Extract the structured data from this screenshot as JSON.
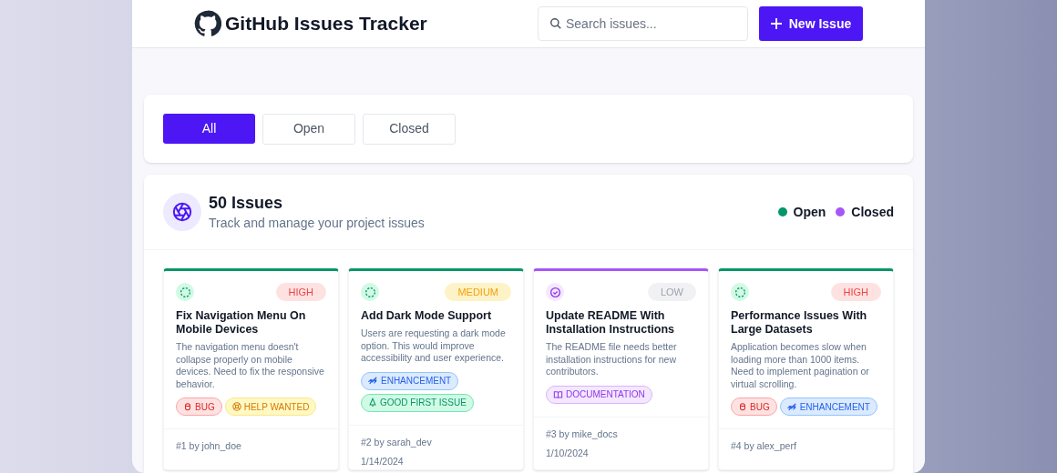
{
  "header": {
    "title": "GitHub Issues Tracker",
    "search": {
      "placeholder": "Search issues..."
    },
    "new_button": "New Issue"
  },
  "filters": [
    {
      "label": "All",
      "selected": true
    },
    {
      "label": "Open",
      "selected": false
    },
    {
      "label": "Closed",
      "selected": false
    }
  ],
  "summary": {
    "title": "50 Issues",
    "subtitle": "Track and manage your project issues",
    "legend": [
      {
        "label": "Open",
        "color": "#059669"
      },
      {
        "label": "Closed",
        "color": "#a855f7"
      }
    ]
  },
  "issues": [
    {
      "closed": false,
      "priority": {
        "label": "HIGH",
        "kind": "high"
      },
      "title": "Fix Navigation Menu On Mobile Devices",
      "description": "The navigation menu doesn't collapse properly on mobile devices. Need to fix the responsive behavior.",
      "labels": [
        {
          "kind": "bug",
          "text": "BUG"
        },
        {
          "kind": "help",
          "text": "HELP WANTED"
        }
      ],
      "meta": "#1 by john_doe"
    },
    {
      "closed": false,
      "priority": {
        "label": "MEDIUM",
        "kind": "medium"
      },
      "title": "Add Dark Mode Support",
      "description": "Users are requesting a dark mode option. This would improve accessibility and user experience.",
      "labels": [
        {
          "kind": "enhancement",
          "text": "ENHANCEMENT"
        },
        {
          "kind": "good_first",
          "text": "GOOD FIRST ISSUE"
        }
      ],
      "meta": "#2 by sarah_dev",
      "date": "1/14/2024"
    },
    {
      "closed": true,
      "priority": {
        "label": "LOW",
        "kind": "low"
      },
      "title": "Update README With Installation Instructions",
      "description": "The README file needs better installation instructions for new contributors.",
      "labels": [
        {
          "kind": "documentation",
          "text": "DOCUMENTATION"
        }
      ],
      "meta": "#3 by mike_docs",
      "date": "1/10/2024"
    },
    {
      "closed": false,
      "priority": {
        "label": "HIGH",
        "kind": "high"
      },
      "title": "Performance Issues With Large Datasets",
      "description": "Application becomes slow when loading more than 1000 items. Need to implement pagination or virtual scrolling.",
      "labels": [
        {
          "kind": "bug",
          "text": "BUG"
        },
        {
          "kind": "enhancement",
          "text": "ENHANCEMENT"
        }
      ],
      "meta": "#4 by alex_perf"
    }
  ]
}
